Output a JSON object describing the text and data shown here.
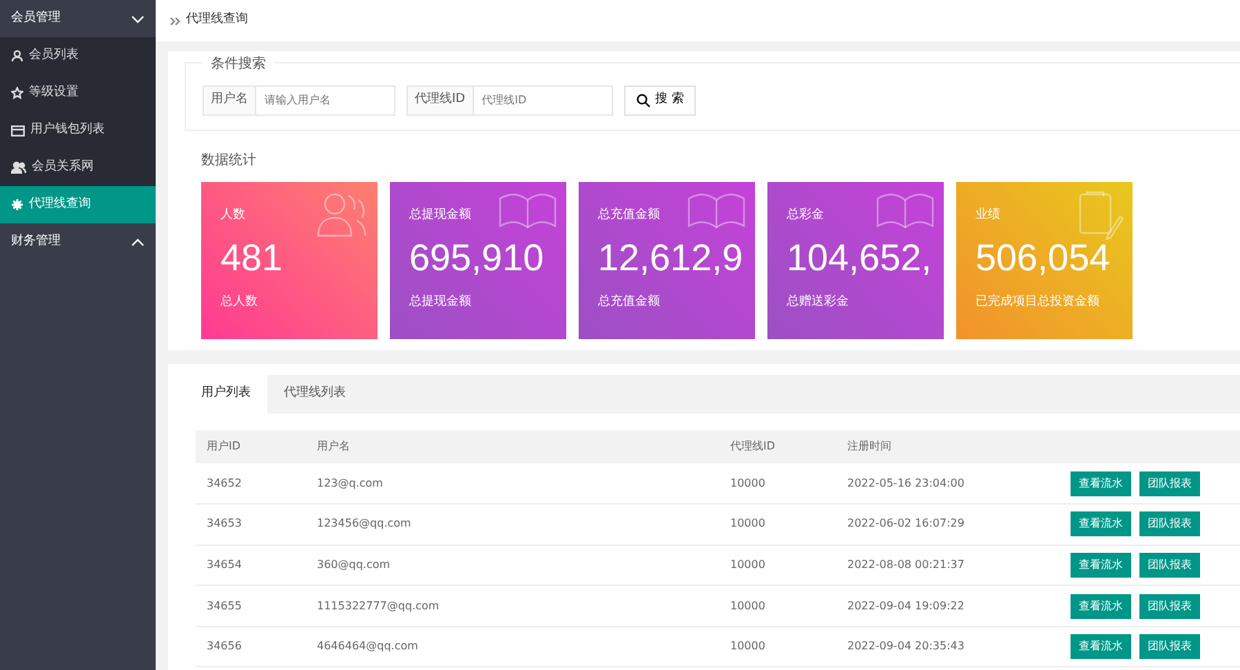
{
  "sidebar": {
    "groups": [
      {
        "label": "会员管理",
        "expanded": true,
        "children": [
          {
            "label": "会员列表",
            "selected": false
          },
          {
            "label": "等级设置",
            "selected": false
          },
          {
            "label": "用户钱包列表",
            "selected": false
          },
          {
            "label": "会员关系网",
            "selected": false
          },
          {
            "label": "代理线查询",
            "selected": true
          }
        ]
      },
      {
        "label": "财务管理",
        "expanded": false
      }
    ]
  },
  "breadcrumb": "代理线查询",
  "search": {
    "legend": "条件搜索",
    "fields": [
      {
        "label": "用户名",
        "placeholder": "请输入用户名"
      },
      {
        "label": "代理线ID",
        "placeholder": "代理线ID"
      }
    ],
    "button": "搜 索"
  },
  "stats": {
    "title": "数据统计",
    "cards": [
      {
        "title": "人数",
        "value": "481",
        "caption": "总人数"
      },
      {
        "title": "总提现金额",
        "value": "695,910",
        "caption": "总提现金额"
      },
      {
        "title": "总充值金额",
        "value": "12,612,9",
        "caption": "总充值金额"
      },
      {
        "title": "总彩金",
        "value": "104,652,",
        "caption": "总赠送彩金"
      },
      {
        "title": "业绩",
        "value": "506,054",
        "caption": "已完成项目总投资金额"
      }
    ]
  },
  "tabs": [
    {
      "label": "用户列表",
      "selected": true
    },
    {
      "label": "代理线列表",
      "selected": false
    }
  ],
  "table": {
    "columns": [
      "用户ID",
      "用户名",
      "代理线ID",
      "注册时间"
    ],
    "rows": [
      {
        "cells": [
          "34652",
          "123@q.com",
          "10000",
          "2022-05-16 23:04:00"
        ],
        "actions": [
          "查看流水",
          "团队报表"
        ]
      },
      {
        "cells": [
          "34653",
          "123456@qq.com",
          "10000",
          "2022-06-02 16:07:29"
        ],
        "actions": [
          "查看流水",
          "团队报表"
        ]
      },
      {
        "cells": [
          "34654",
          "360@qq.com",
          "10000",
          "2022-08-08 00:21:37"
        ],
        "actions": [
          "查看流水",
          "团队报表"
        ]
      },
      {
        "cells": [
          "34655",
          "1115322777@qq.com",
          "10000",
          "2022-09-04 19:09:22"
        ],
        "actions": [
          "查看流水",
          "团队报表"
        ]
      },
      {
        "cells": [
          "34656",
          "4646464@qq.com",
          "10000",
          "2022-09-04 20:35:43"
        ],
        "actions": [
          "查看流水",
          "团队报表"
        ]
      }
    ]
  }
}
